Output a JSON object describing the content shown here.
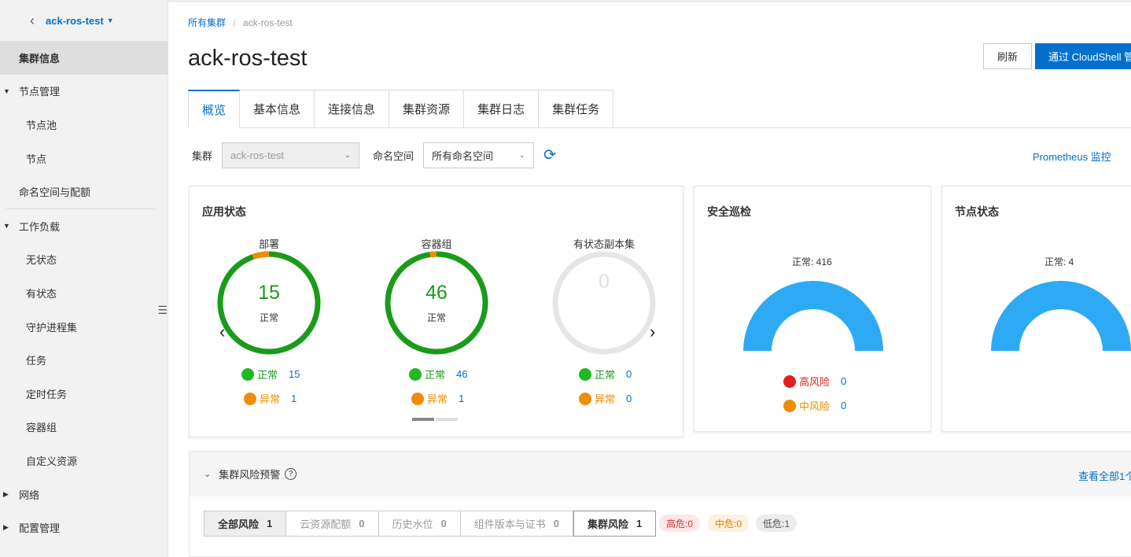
{
  "sidebar": {
    "cluster_name": "ack-ros-test",
    "items": [
      {
        "label": "集群信息"
      },
      {
        "label": "节点管理"
      },
      {
        "label": "节点池"
      },
      {
        "label": "节点"
      },
      {
        "label": "命名空间与配额"
      },
      {
        "label": "工作负载"
      },
      {
        "label": "无状态"
      },
      {
        "label": "有状态"
      },
      {
        "label": "守护进程集"
      },
      {
        "label": "任务"
      },
      {
        "label": "定时任务"
      },
      {
        "label": "容器组"
      },
      {
        "label": "自定义资源"
      },
      {
        "label": "网络"
      },
      {
        "label": "配置管理"
      }
    ]
  },
  "breadcrumb": {
    "root": "所有集群",
    "sep": "/",
    "current": "ack-ros-test"
  },
  "page_title": "ack-ros-test",
  "buttons": {
    "refresh": "刷新",
    "cloudshell": "通过 CloudShell 管"
  },
  "tabs": [
    "概览",
    "基本信息",
    "连接信息",
    "集群资源",
    "集群日志",
    "集群任务"
  ],
  "filters": {
    "cluster_label": "集群",
    "cluster_value": "ack-ros-test",
    "namespace_label": "命名空间",
    "namespace_value": "所有命名空间",
    "prometheus_link": "Prometheus 监控"
  },
  "app_status": {
    "title": "应用状态",
    "rings": [
      {
        "label": "部署",
        "total": "15",
        "sub": "正常",
        "normal_label": "正常",
        "normal": "15",
        "abnormal_label": "异常",
        "abnormal": "1"
      },
      {
        "label": "容器组",
        "total": "46",
        "sub": "正常",
        "normal_label": "正常",
        "normal": "46",
        "abnormal_label": "异常",
        "abnormal": "1"
      },
      {
        "label": "有状态副本集",
        "total": "0",
        "sub": "",
        "normal_label": "正常",
        "normal": "0",
        "abnormal_label": "异常",
        "abnormal": "0"
      }
    ]
  },
  "security": {
    "title": "安全巡检",
    "gauge_label": "正常: 416",
    "high_label": "高风险",
    "high": "0",
    "mid_label": "中风险",
    "mid": "0"
  },
  "node_status": {
    "title": "节点状态",
    "gauge_label": "正常: 4"
  },
  "risk": {
    "title": "集群风险预警",
    "help": "?",
    "view_all": "查看全部1个",
    "tabs": [
      {
        "label": "全部风险",
        "count": "1"
      },
      {
        "label": "云资源配额",
        "count": "0"
      },
      {
        "label": "历史水位",
        "count": "0"
      },
      {
        "label": "组件版本与证书",
        "count": "0"
      },
      {
        "label": "集群风险",
        "count": "1"
      }
    ],
    "badges": {
      "high": "高危:0",
      "mid": "中危:0",
      "low": "低危:1"
    }
  },
  "colors": {
    "accent": "#0070cc",
    "normal": "#1a9b1a",
    "abnormal": "#f08c00",
    "gauge": "#2eaaf5",
    "danger": "#e02020"
  }
}
